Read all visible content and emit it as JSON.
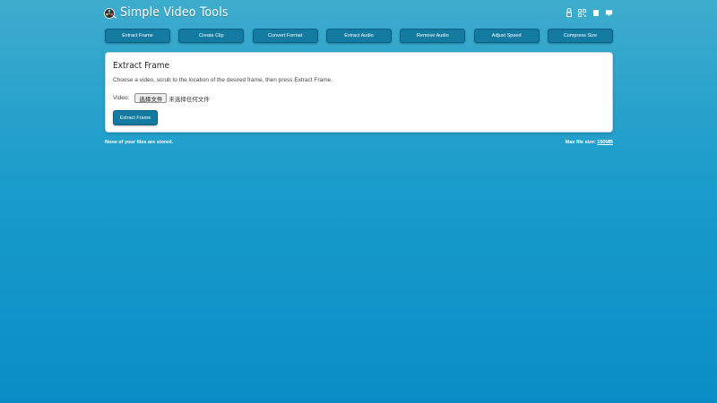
{
  "header": {
    "title": "Simple Video Tools",
    "logo_icon": "film-reel-icon",
    "icons": [
      "person-icon",
      "qr-code-icon",
      "tablet-icon",
      "monitor-icon"
    ]
  },
  "nav": {
    "items": [
      "Extract Frame",
      "Create Clip",
      "Convert Format",
      "Extract Audio",
      "Remove Audio",
      "Adjust Speed",
      "Compress Size"
    ]
  },
  "card": {
    "title": "Extract Frame",
    "description": "Choose a video, scrub to the location of the desired frame, then press Extract Frame.",
    "video_label": "Video:",
    "file_button": "选择文件",
    "file_status": "未选择任何文件",
    "action_label": "Extract Frame"
  },
  "footer": {
    "left_text": "None of your files are stored.",
    "max_size_label": "Max file size:",
    "max_size_value": "150MB"
  },
  "colors": {
    "button_bg": "#137ba1",
    "background_top": "#3eaccd",
    "background_bottom": "#0a8dc6"
  }
}
